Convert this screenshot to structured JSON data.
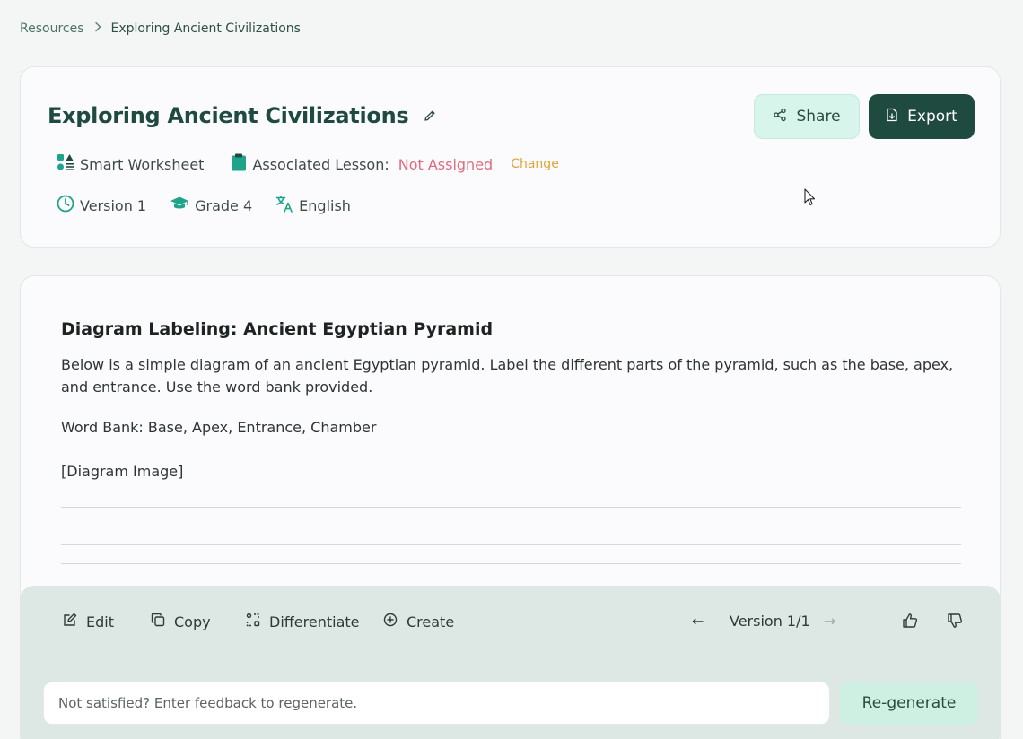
{
  "breadcrumb": {
    "parent": "Resources",
    "separator": ">",
    "current": "Exploring Ancient Civilizations"
  },
  "header": {
    "title": "Exploring Ancient Civilizations",
    "share_label": "Share",
    "export_label": "Export",
    "type_label": "Smart Worksheet",
    "lesson_label": "Associated Lesson:",
    "lesson_value": "Not Assigned",
    "change_label": "Change",
    "version_label": "Version 1",
    "grade_label": "Grade 4",
    "language_label": "English"
  },
  "content": {
    "section_title": "Diagram Labeling: Ancient Egyptian Pyramid",
    "instructions": "Below is a simple diagram of an ancient Egyptian pyramid. Label the different parts of the pyramid, such as the base, apex, and entrance. Use the word bank provided.",
    "word_bank": "Word Bank: Base, Apex, Entrance, Chamber",
    "diagram_placeholder": "[Diagram Image]"
  },
  "toolbar": {
    "edit_label": "Edit",
    "copy_label": "Copy",
    "differentiate_label": "Differentiate",
    "create_label": "Create",
    "version_nav_label": "Version 1/1",
    "prev_arrow": "←",
    "next_arrow": "→"
  },
  "feedback": {
    "placeholder": "Not satisfied? Enter feedback to regenerate.",
    "regenerate_label": "Re-generate"
  },
  "colors": {
    "primary": "#1e4a40",
    "accent_light": "#d7f5ea",
    "not_assigned": "#e06b7d",
    "change_link": "#e0a33a",
    "icon_teal": "#1fa38a"
  }
}
